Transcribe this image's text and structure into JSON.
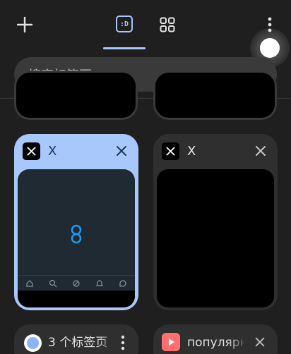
{
  "toolbar": {
    "new_tab_icon": "plus-icon",
    "incognito_badge": ":D",
    "grid_icon": "grid-icon",
    "more_icon": "more-vert-icon"
  },
  "search": {
    "placeholder": "搜索标签页"
  },
  "tabs": [
    {
      "title": "X",
      "favicon": "x-logo-icon",
      "selected": true
    },
    {
      "title": "X",
      "favicon": "x-logo-icon",
      "selected": false
    }
  ],
  "bottom_cards": [
    {
      "title": "3 个标签页",
      "icon": "tab-group-icon"
    },
    {
      "title": "популярное",
      "icon": "youtube-icon"
    }
  ],
  "colors": {
    "accent": "#a8c7fa",
    "background": "#1f1f1f",
    "card": "#2f2f2f",
    "search_bg": "#3a3a3a"
  }
}
